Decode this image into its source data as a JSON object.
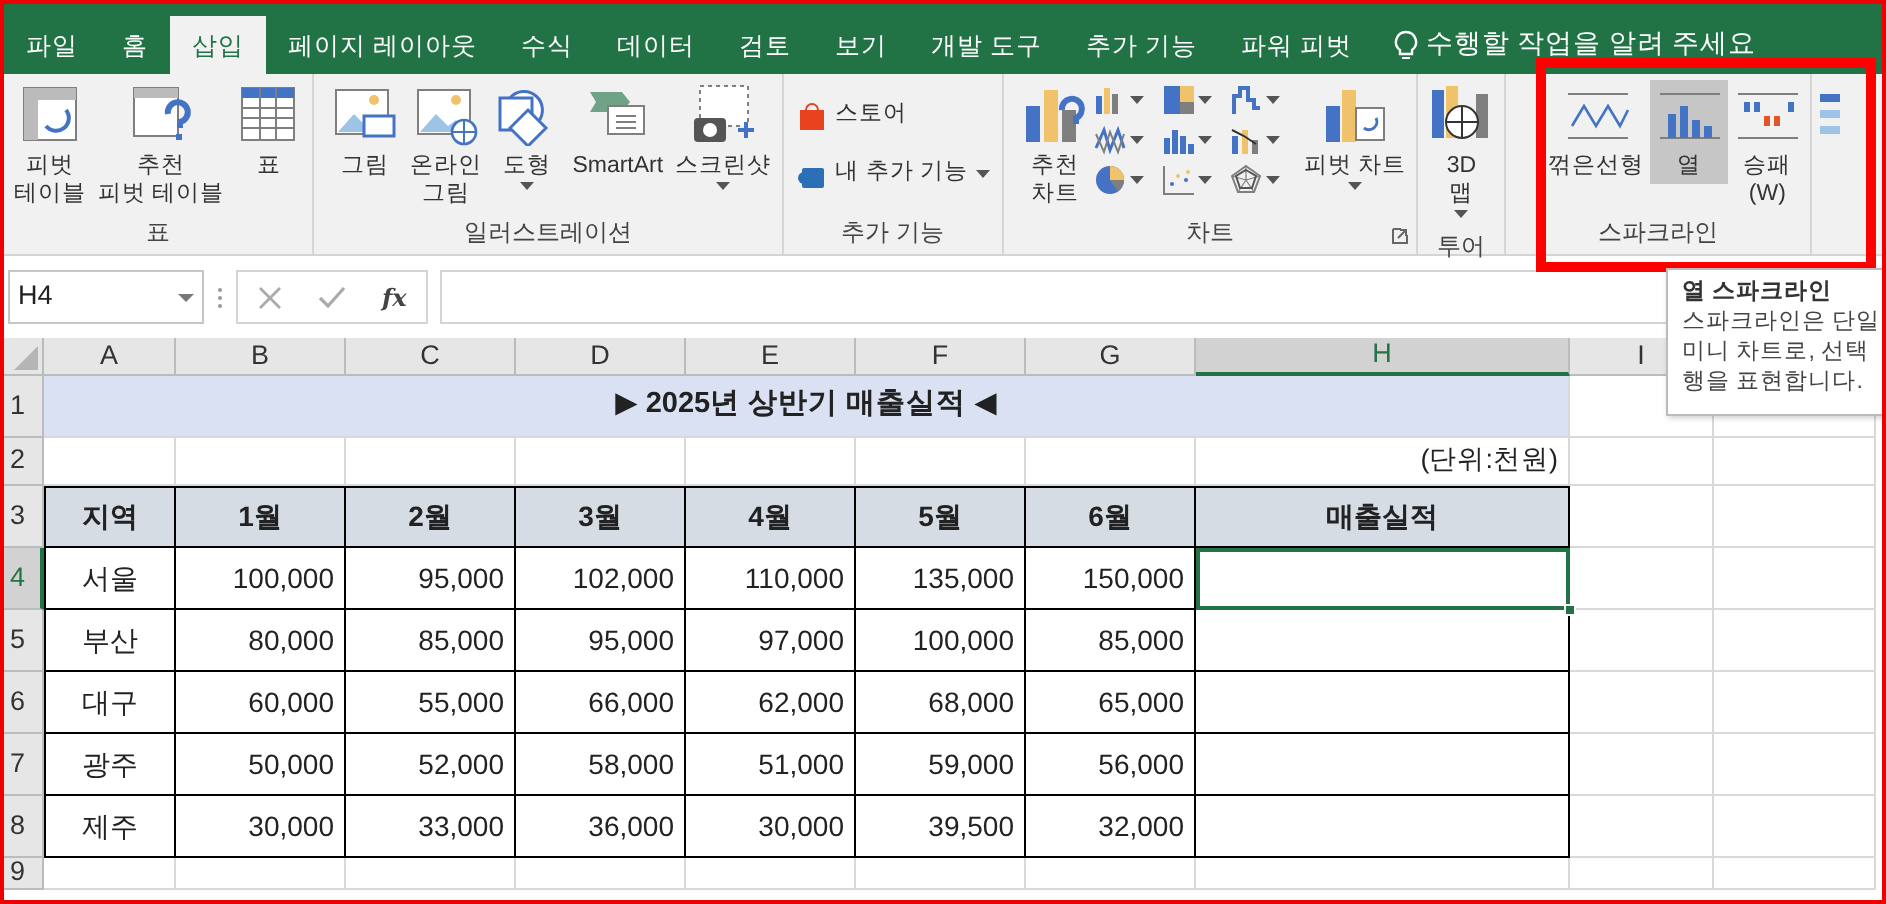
{
  "tabs": [
    {
      "label": "파일",
      "selected": false
    },
    {
      "label": "홈",
      "selected": false
    },
    {
      "label": "삽입",
      "selected": true
    },
    {
      "label": "페이지 레이아웃",
      "selected": false
    },
    {
      "label": "수식",
      "selected": false
    },
    {
      "label": "데이터",
      "selected": false
    },
    {
      "label": "검토",
      "selected": false
    },
    {
      "label": "보기",
      "selected": false
    },
    {
      "label": "개발 도구",
      "selected": false
    },
    {
      "label": "추가 기능",
      "selected": false
    },
    {
      "label": "파워 피벗",
      "selected": false
    }
  ],
  "tell_me": "수행할 작업을 알려 주세요",
  "ribbon_groups": [
    {
      "label": "표",
      "items": [
        {
          "kind": "large",
          "lines": [
            "피벗",
            "테이블"
          ]
        },
        {
          "kind": "large",
          "lines": [
            "추천",
            "피벗 테이블"
          ]
        },
        {
          "kind": "large",
          "lines": [
            "표"
          ]
        }
      ]
    },
    {
      "label": "일러스트레이션",
      "items": [
        {
          "kind": "large",
          "lines": [
            "그림"
          ]
        },
        {
          "kind": "large",
          "lines": [
            "온라인",
            "그림"
          ]
        },
        {
          "kind": "large",
          "lines": [
            "도형"
          ],
          "dropdown": true
        },
        {
          "kind": "large",
          "lines": [
            "SmartArt"
          ]
        },
        {
          "kind": "large",
          "lines": [
            "스크린샷"
          ],
          "dropdown": true
        }
      ]
    },
    {
      "label": "추가 기능",
      "items": [
        {
          "kind": "stack",
          "buttons": [
            {
              "label": "스토어",
              "dropdown": false
            },
            {
              "label": "내 추가 기능",
              "dropdown": true
            }
          ]
        }
      ]
    },
    {
      "label": "차트",
      "launcher": true,
      "items": [
        {
          "kind": "large",
          "lines": [
            "추천",
            "차트"
          ]
        },
        {
          "kind": "gallery"
        },
        {
          "kind": "large",
          "lines": [
            "피벗 차트"
          ],
          "dropdown": true
        }
      ]
    },
    {
      "label": "투어",
      "items": [
        {
          "kind": "large",
          "lines": [
            "3D",
            "맵"
          ],
          "dropdown": true
        }
      ]
    },
    {
      "label": "스파크라인",
      "highlighted": true,
      "items": [
        {
          "kind": "large",
          "lines": [
            "꺾은선형"
          ],
          "selected": false
        },
        {
          "kind": "large",
          "lines": [
            "열"
          ],
          "selected": true
        },
        {
          "kind": "large",
          "lines": [
            "승패",
            "(W)"
          ],
          "selected": false
        }
      ]
    }
  ],
  "formula_bar": {
    "name_box": "H4",
    "fx": "fx"
  },
  "sheet": {
    "columns": [
      {
        "label": "A",
        "selected": false
      },
      {
        "label": "B",
        "selected": false
      },
      {
        "label": "C",
        "selected": false
      },
      {
        "label": "D",
        "selected": false
      },
      {
        "label": "E",
        "selected": false
      },
      {
        "label": "F",
        "selected": false
      },
      {
        "label": "G",
        "selected": false
      },
      {
        "label": "H",
        "selected": true
      },
      {
        "label": "I",
        "selected": false
      }
    ],
    "row_numbers": [
      {
        "label": "1",
        "selected": false
      },
      {
        "label": "2",
        "selected": false
      },
      {
        "label": "3",
        "selected": false
      },
      {
        "label": "4",
        "selected": true
      },
      {
        "label": "5",
        "selected": false
      },
      {
        "label": "6",
        "selected": false
      },
      {
        "label": "7",
        "selected": false
      },
      {
        "label": "8",
        "selected": false
      },
      {
        "label": "9",
        "selected": false
      }
    ],
    "title": "▶ 2025년 상반기 매출실적 ◀",
    "unit": "(단위:천원)",
    "header": [
      "지역",
      "1월",
      "2월",
      "3월",
      "4월",
      "5월",
      "6월",
      "매출실적"
    ],
    "rows": [
      {
        "cells": [
          "서울",
          "100,000",
          "95,000",
          "102,000",
          "110,000",
          "135,000",
          "150,000"
        ],
        "active": true
      },
      {
        "cells": [
          "부산",
          "80,000",
          "85,000",
          "95,000",
          "97,000",
          "100,000",
          "85,000"
        ],
        "active": false
      },
      {
        "cells": [
          "대구",
          "60,000",
          "55,000",
          "66,000",
          "62,000",
          "68,000",
          "65,000"
        ],
        "active": false
      },
      {
        "cells": [
          "광주",
          "50,000",
          "52,000",
          "58,000",
          "51,000",
          "59,000",
          "56,000"
        ],
        "active": false
      },
      {
        "cells": [
          "제주",
          "30,000",
          "33,000",
          "36,000",
          "30,000",
          "39,500",
          "32,000"
        ],
        "active": false
      }
    ]
  },
  "tooltip": {
    "title": "열 스파크라인",
    "lines": [
      "스파크라인은 단일",
      "미니 차트로, 선택",
      "행을 표현합니다."
    ]
  }
}
